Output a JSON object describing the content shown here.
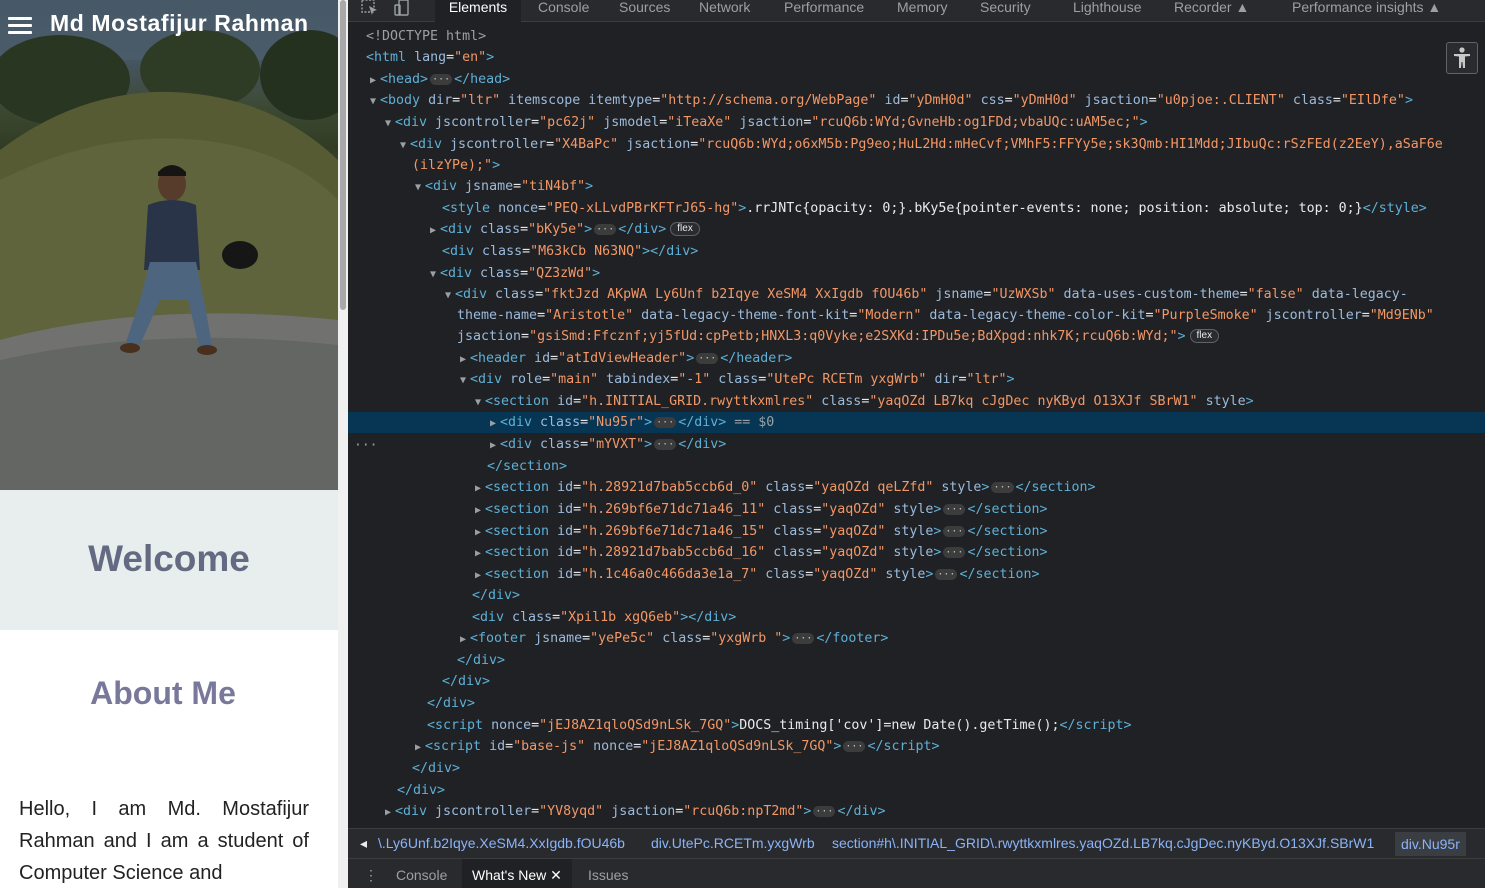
{
  "site": {
    "title": "Md Mostafijur Rahman",
    "welcome": "Welcome",
    "about_heading": "About Me",
    "about_text": "Hello, I am Md. Mostafijur Rahman and I am a student of Computer Science and"
  },
  "devtools": {
    "tabs": [
      "Elements",
      "Console",
      "Sources",
      "Network",
      "Performance",
      "Memory",
      "Security",
      "Lighthouse",
      "Recorder",
      "Performance insights"
    ],
    "active_tab": "Elements",
    "badges": {
      "flex": "flex",
      "selected_marker": "== $0"
    },
    "tree": {
      "l1": "<!DOCTYPE html>",
      "html_tag": "html",
      "lang_attr": "lang",
      "lang_val": "\"en\"",
      "head_tag": "head",
      "body_tag": "body",
      "body_attrs": [
        [
          "dir",
          "\"ltr\""
        ],
        [
          "itemscope",
          ""
        ],
        [
          "itemtype",
          "\"http://schema.org/WebPage\""
        ],
        [
          "id",
          "\"yDmH0d\""
        ],
        [
          "css",
          "\"yDmH0d\""
        ],
        [
          "jsaction",
          "\"u0pjoe:.CLIENT\""
        ],
        [
          "class",
          "\"EIlDfe\""
        ]
      ],
      "div_pc62j": {
        "jscontroller": "\"pc62j\"",
        "jsmodel": "\"iTeaXe\"",
        "jsaction": "\"rcuQ6b:WYd;GvneHb:og1FDd;vbaUQc:uAM5ec;\""
      },
      "div_x4bapc": {
        "jscontroller": "\"X4BaPc\"",
        "jsaction": "\"rcuQ6b:WYd;o6xM5b:Pg9eo;HuL2Hd:mHeCvf;VMhF5:FFYy5e;sk3Qmb:HI1Mdd;JIbuQc:rSzFEd(z2EeY),aSaF6e",
        "jsaction_cont": "(ilzYPe);\""
      },
      "div_tin4bf": "\"tiN4bf\"",
      "style_nonce": "\"PEQ-xLLvdPBrKFTrJ65-hg\"",
      "style_text": ".rrJNTc{opacity: 0;}.bKy5e{pointer-events: none; position: absolute; top: 0;}",
      "div_bky5e": "\"bKy5e\"",
      "div_m63kcb": "\"M63kCb N63NQ\"",
      "div_qz3zwd": "\"QZ3zWd\"",
      "div_fktjzd": {
        "class": "\"fktJzd AKpWA Ly6Unf b2Iqye XeSM4 XxIgdb fOU46b\"",
        "jsname": "\"UzWXSb\"",
        "data_uses_custom_theme": "\"false\"",
        "legacy_name": "\"Aristotle\"",
        "font_kit": "\"Modern\"",
        "color_kit": "\"PurpleSmoke\"",
        "jscontroller": "\"Md9ENb\"",
        "jsaction": "\"gsiSmd:Ffcznf;yj5fUd:cpPetb;HNXL3:q0Vyke;e2SXKd:IPDu5e;BdXpgd:nhk7K;rcuQ6b:WYd;\""
      },
      "header_id": "\"atIdViewHeader\"",
      "main_div": {
        "role": "\"main\"",
        "tabindex": "\"-1\"",
        "class": "\"UtePc RCETm yxgWrb\"",
        "dir": "\"ltr\""
      },
      "section_grid": {
        "id": "\"h.INITIAL_GRID.rwyttkxmlres\"",
        "class": "\"yaqOZd LB7kq cJgDec nyKByd O13XJf SBrW1\""
      },
      "div_nu95r": "\"Nu95r\"",
      "div_myvxt": "\"mYVXT\"",
      "sections": [
        {
          "id": "\"h.28921d7bab5ccb6d_0\"",
          "class": "\"yaqOZd qeLZfd\""
        },
        {
          "id": "\"h.269bf6e71dc71a46_11\"",
          "class": "\"yaqOZd\""
        },
        {
          "id": "\"h.269bf6e71dc71a46_15\"",
          "class": "\"yaqOZd\""
        },
        {
          "id": "\"h.28921d7bab5ccb6d_16\"",
          "class": "\"yaqOZd\""
        },
        {
          "id": "\"h.1c46a0c466da3e1a_7\"",
          "class": "\"yaqOZd\""
        }
      ],
      "div_xpil1b": "\"Xpil1b xgQ6eb\"",
      "footer": {
        "jsname": "\"yePe5c\"",
        "class": "\"yxgWrb \""
      },
      "script1_nonce": "\"jEJ8AZ1qloQSd9nLSk_7GQ\"",
      "script1_text": "DOCS_timing['cov']=new Date().getTime();",
      "script2_id": "\"base-js\"",
      "script2_nonce": "\"jEJ8AZ1qloQSd9nLSk_7GQ\"",
      "div_yv8yqd": {
        "jscontroller": "\"YV8yqd\"",
        "jsaction": "\"rcuQ6b:npT2md\""
      }
    },
    "breadcrumbs": [
      "\\.Ly6Unf.b2Iqye.XeSM4.XxIgdb.fOU46b",
      "div.UtePc.RCETm.yxgWrb",
      "section#h\\.INITIAL_GRID\\.rwyttkxmlres.yaqOZd.LB7kq.cJgDec.nyKByd.O13XJf.SBrW1",
      "div.Nu95r"
    ],
    "drawer_tabs": [
      "Console",
      "What's New",
      "Issues"
    ],
    "drawer_active": "What's New",
    "close_glyph": "✕"
  }
}
